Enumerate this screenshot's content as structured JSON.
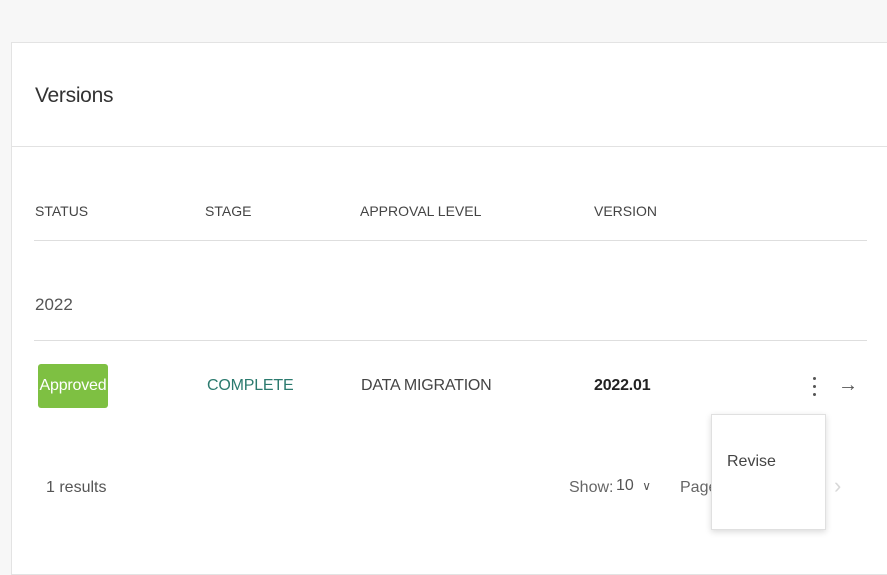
{
  "card": {
    "title": "Versions"
  },
  "columns": {
    "status": "STATUS",
    "stage": "STAGE",
    "approval_level": "APPROVAL LEVEL",
    "version": "VERSION"
  },
  "groups": [
    {
      "label": "2022",
      "rows": [
        {
          "status": "Approved",
          "stage": "COMPLETE",
          "approval_level": "DATA MIGRATION",
          "version": "2022.01"
        }
      ]
    }
  ],
  "footer": {
    "results": "1 results",
    "show_label": "Show:",
    "page_size": "10",
    "page_label": "Page"
  },
  "row_menu": {
    "items": [
      {
        "label": "Revise"
      }
    ]
  },
  "colors": {
    "approved_badge": "#7ec042",
    "stage_text": "#2b7a6e"
  },
  "icons": {
    "kebab": "more-vertical-icon",
    "arrow": "arrow-right-icon",
    "chevron_down": "chevron-down-icon",
    "chevron_right": "chevron-right-icon"
  }
}
